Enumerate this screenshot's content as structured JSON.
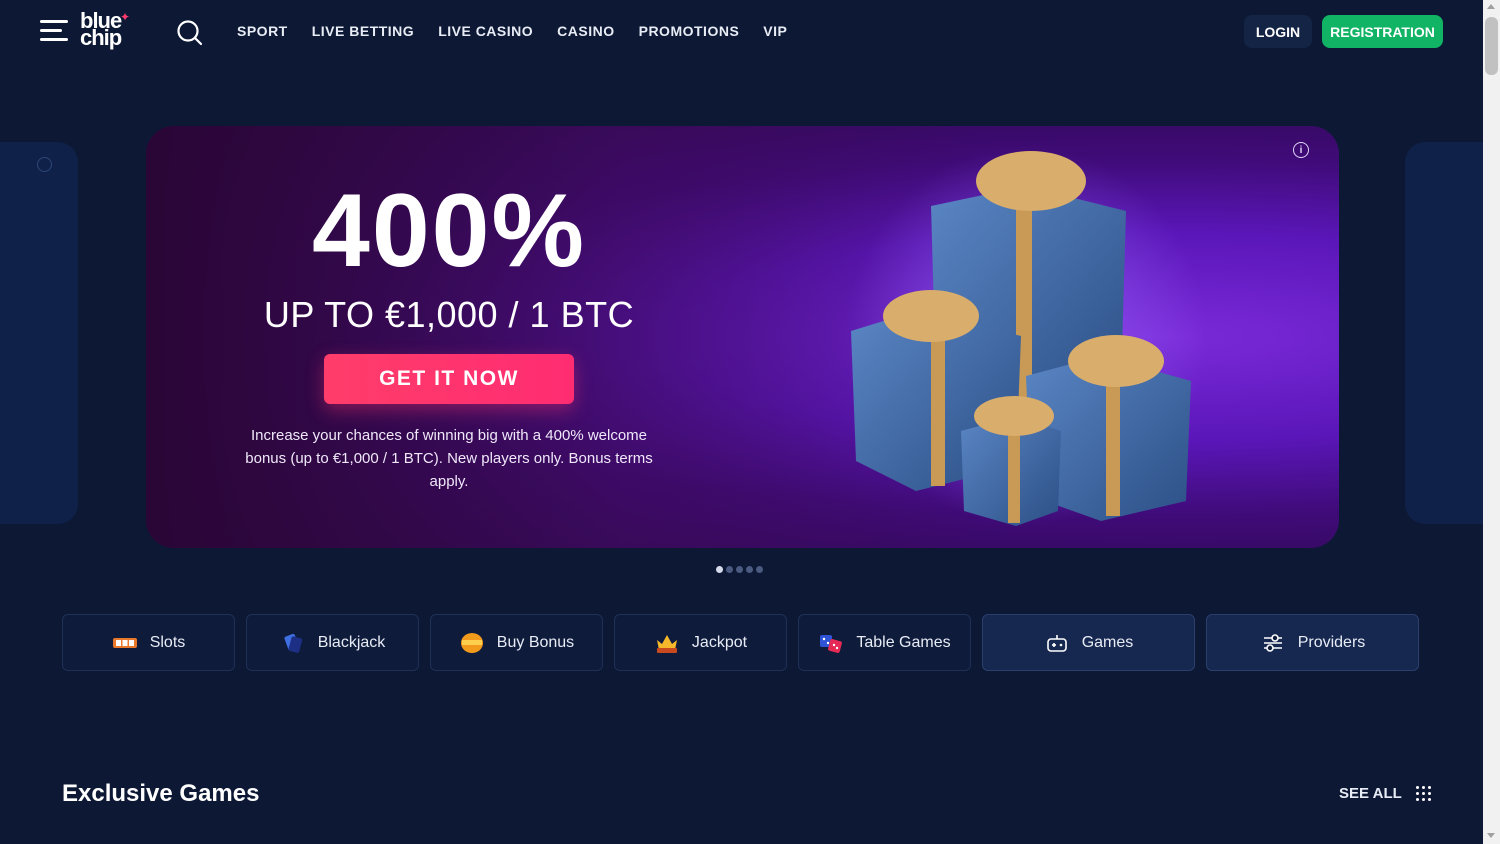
{
  "header": {
    "logo_line1": "blue",
    "logo_line2": "chip",
    "nav": [
      "SPORT",
      "LIVE BETTING",
      "LIVE CASINO",
      "CASINO",
      "PROMOTIONS",
      "VIP"
    ],
    "login_label": "LOGIN",
    "registration_label": "REGISTRATION"
  },
  "banner": {
    "headline": "400%",
    "subheadline": "UP TO €1,000 / 1 BTC",
    "cta_label": "GET IT NOW",
    "description": "Increase your chances of winning big with a 400% welcome bonus (up to €1,000 / 1 BTC). New players only. Bonus terms apply.",
    "info_icon": "info-icon",
    "slide_count": 5,
    "active_slide": 1
  },
  "categories": [
    {
      "label": "Slots",
      "icon": "slots-icon"
    },
    {
      "label": "Blackjack",
      "icon": "blackjack-icon"
    },
    {
      "label": "Buy Bonus",
      "icon": "buy-bonus-icon"
    },
    {
      "label": "Jackpot",
      "icon": "jackpot-icon"
    },
    {
      "label": "Table Games",
      "icon": "table-games-icon"
    },
    {
      "label": "Games",
      "icon": "gamepad-icon"
    },
    {
      "label": "Providers",
      "icon": "providers-icon"
    }
  ],
  "section": {
    "title": "Exclusive Games",
    "see_all_label": "SEE ALL"
  },
  "colors": {
    "background": "#0c1834",
    "registration": "#10b464",
    "cta": "#ff2c72",
    "banner_purple": "#5a16b8"
  }
}
